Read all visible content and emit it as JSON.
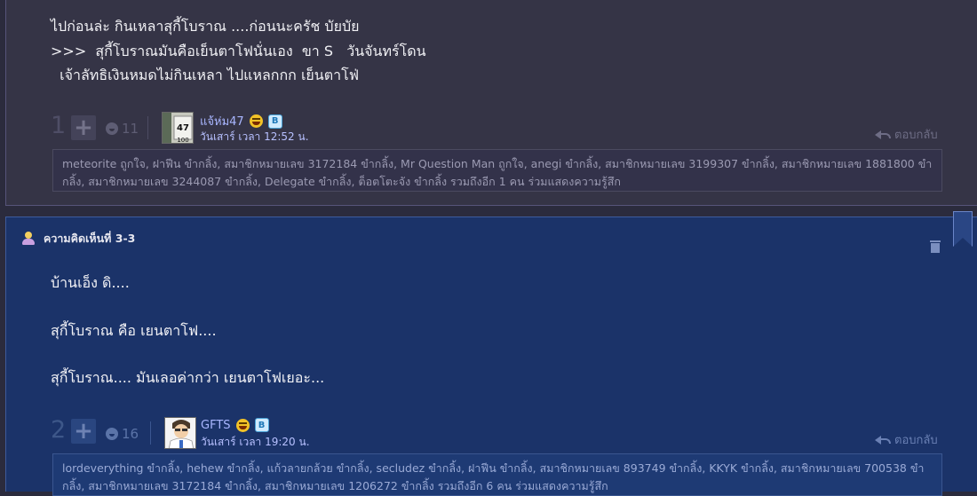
{
  "comment1": {
    "lines": [
      "ไปก่อนล่ะ กินเหลาสุกี้โบราณ ....ก่อนนะครัช บัยบัย",
      ">>>  สุกี้โบราณมันคือเย็นตาโฟนั่นเอง  ขา S   วันจันทร์โดน",
      "  เจ้าลัทธิเงินหมดไม่กินเหลา ไปแหลกกก เย็นตาโฟ่"
    ],
    "vote_number": "1",
    "emotion_count": "11",
    "author": {
      "name": "แจ้ห่ม47",
      "avatar_text": "47",
      "avatar_sub": "100",
      "time": "วันเสาร์ เวลา 12:52 น."
    },
    "reply_label": "ตอบกลับ",
    "likes_text": "meteorite ถูกใจ, ฝาฟีน ขำกลิ้ง, สมาชิกหมายเลข 3172184 ขำกลิ้ง, Mr Question Man ถูกใจ, anegi ขำกลิ้ง, สมาชิกหมายเลข 3199307 ขำกลิ้ง, สมาชิกหมายเลข 1881800 ขำกลิ้ง, สมาชิกหมายเลข 3244087 ขำกลิ้ง, Delegate ขำกลิ้ง, ต็อตโตะจัง ขำกลิ้ง รวมถึงอีก 1 คน ร่วมแสดงความรู้สึก"
  },
  "comment2": {
    "header": "ความคิดเห็นที่ 3-3",
    "lines": [
      "บ้านเอ็ง ดิ....",
      "สุกี้โบราณ คือ เยนตาโฟ....",
      "สุกี้โบราณ.... มันเลอค่ากว่า เยนตาโฟเยอะ..."
    ],
    "vote_number": "2",
    "emotion_count": "16",
    "author": {
      "name": "GFTS",
      "time": "วันเสาร์ เวลา 19:20 น."
    },
    "reply_label": "ตอบกลับ",
    "likes_text": "lordeverything ขำกลิ้ง, hehew ขำกลิ้ง, แก้วลายกล้วย ขำกลิ้ง, secludez ขำกลิ้ง, ฝาฟีน ขำกลิ้ง, สมาชิกหมายเลข 893749 ขำกลิ้ง, KKYK ขำกลิ้ง, สมาชิกหมายเลข 700538 ขำกลิ้ง, สมาชิกหมายเลข 3172184 ขำกลิ้ง, สมาชิกหมายเลข 1206272 ขำกลิ้ง รวมถึงอีก 6 คน ร่วมแสดงความรู้สึก"
  },
  "icons": {
    "plus": "+",
    "blog_badge": "B"
  },
  "colors": {
    "comment1_bg": "#353446",
    "comment2_bg": "#1b3369",
    "username": "#a9b6ff"
  }
}
